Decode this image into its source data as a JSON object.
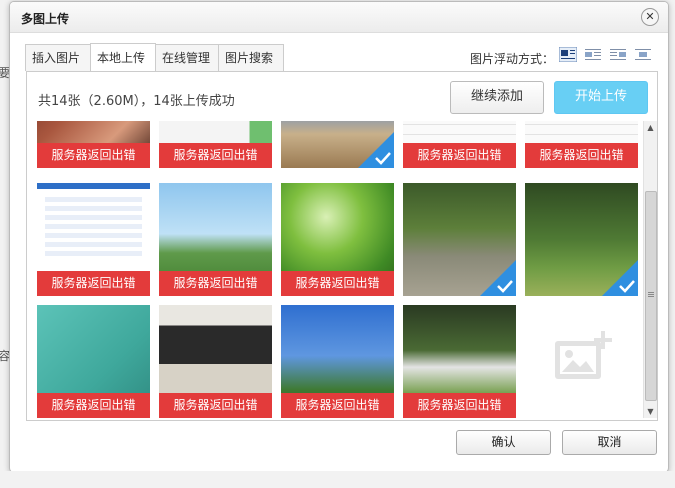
{
  "dialog": {
    "title": "多图上传",
    "close_glyph": "✕"
  },
  "side_text": {
    "left_char_1": "要",
    "left_char_2": "容"
  },
  "tabs": [
    {
      "label": "插入图片"
    },
    {
      "label": "本地上传",
      "active": true
    },
    {
      "label": "在线管理"
    },
    {
      "label": "图片搜索"
    }
  ],
  "float_mode": {
    "label": "图片浮动方式："
  },
  "upload": {
    "status": "共14张（2.60M），14张上传成功",
    "add_button": "继续添加",
    "start_button": "开始上传"
  },
  "tiles": {
    "error_text": "服务器返回出错"
  },
  "footer": {
    "ok": "确认",
    "cancel": "取消"
  },
  "colors": {
    "error": "#e33b3b",
    "accent": "#68cff4",
    "check": "#2f8fe0"
  }
}
